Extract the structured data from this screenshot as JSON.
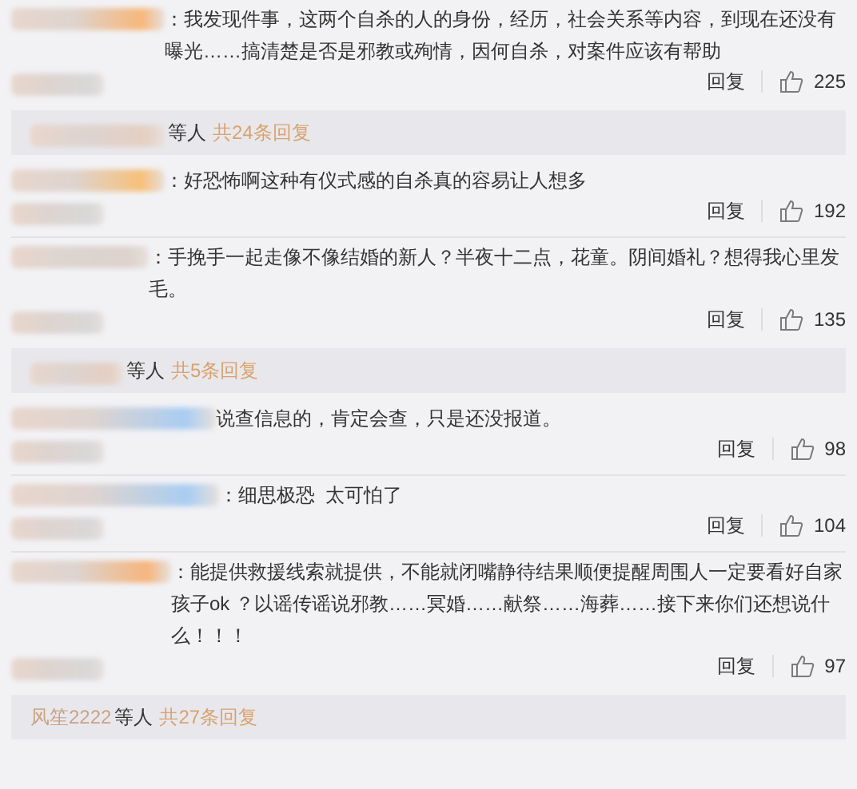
{
  "comments": [
    {
      "text": "：我发现件事，这两个自杀的人的身份，经历，社会关系等内容，到现在还没有曝光……搞清楚是否是邪教或殉情，因何自杀，对案件应该有帮助",
      "reply_label": "回复",
      "likes": "225",
      "replies": {
        "suffix": "等人",
        "count": "共24条回复"
      }
    },
    {
      "text": "：好恐怖啊这种有仪式感的自杀真的容易让人想多",
      "reply_label": "回复",
      "likes": "192"
    },
    {
      "text": "：手挽手一起走像不像结婚的新人？半夜十二点，花童。阴间婚礼？想得我心里发毛。",
      "reply_label": "回复",
      "likes": "135",
      "replies": {
        "suffix": "等人",
        "count": "共5条回复"
      }
    },
    {
      "text": "说查信息的，肯定会查，只是还没报道。",
      "reply_label": "回复",
      "likes": "98"
    },
    {
      "text": "：细思极恐  太可怕了",
      "reply_label": "回复",
      "likes": "104"
    },
    {
      "text": "：能提供救援线索就提供，不能就闭嘴静待结果顺便提醒周围人一定要看好自家孩子ok ？以谣传谣说邪教……冥婚……献祭……海葬……接下来你们还想说什么！！！",
      "reply_label": "回复",
      "likes": "97",
      "replies": {
        "name": "风笙2222",
        "suffix": "等人",
        "count": "共27条回复"
      }
    }
  ]
}
